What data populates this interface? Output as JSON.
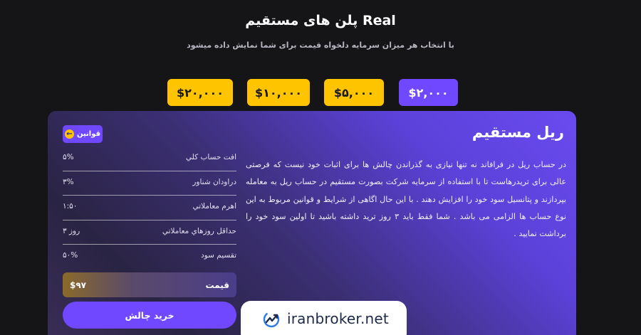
{
  "header": {
    "title": "پلن های مستقیم Real",
    "subtitle": "با انتخاب هر میزان سرمایه دلخواه قیمت برای شما نمایش داده میشود"
  },
  "plans": [
    {
      "label": "$۲۰,۰۰۰",
      "state": "default"
    },
    {
      "label": "$۱۰,۰۰۰",
      "state": "default"
    },
    {
      "label": "$۵,۰۰۰",
      "state": "default"
    },
    {
      "label": "$۲,۰۰۰",
      "state": "selected"
    }
  ],
  "card": {
    "title": "ریل مستقیم",
    "rules_label": "قوانین",
    "description": "در حساب ریل در فرافاند نه تنها نیازی به گذراندن چالش ها برای اثبات خود نیست که فرصتی عالی برای تریدرهاست تا با استفاده از سرمایه شرکت بصورت مستقیم در حساب ریل به معامله بپردازند و پتانسیل سود خود را افزایش دهند . با این حال اگاهی از شرایط و قوانین مربوط به این نوع حساب ها الزامی می باشد . شما فقط باید ۳ روز ترید داشته باشید تا اولین سود خود را برداشت نمایید .",
    "rows": [
      {
        "label": "افت حساب کلي",
        "value": "۵%"
      },
      {
        "label": "دراودان شناور",
        "value": "۳%"
      },
      {
        "label": "اهرم معاملاتي",
        "value": "۱:۵۰"
      },
      {
        "label": "حداقل روزهاي معاملاتي",
        "value": "۳ روز"
      },
      {
        "label": "تقسیم سود",
        "value": "۵۰%"
      }
    ],
    "price_label": "قیمت",
    "price_value": "$۹۷",
    "buy_label": "خرید چالش"
  },
  "watermark": {
    "text": "iranbroker.net",
    "icon": "chart-logo-icon"
  },
  "colors": {
    "accent": "#7048ff",
    "yellow": "#ffc400",
    "background": "#151417"
  }
}
